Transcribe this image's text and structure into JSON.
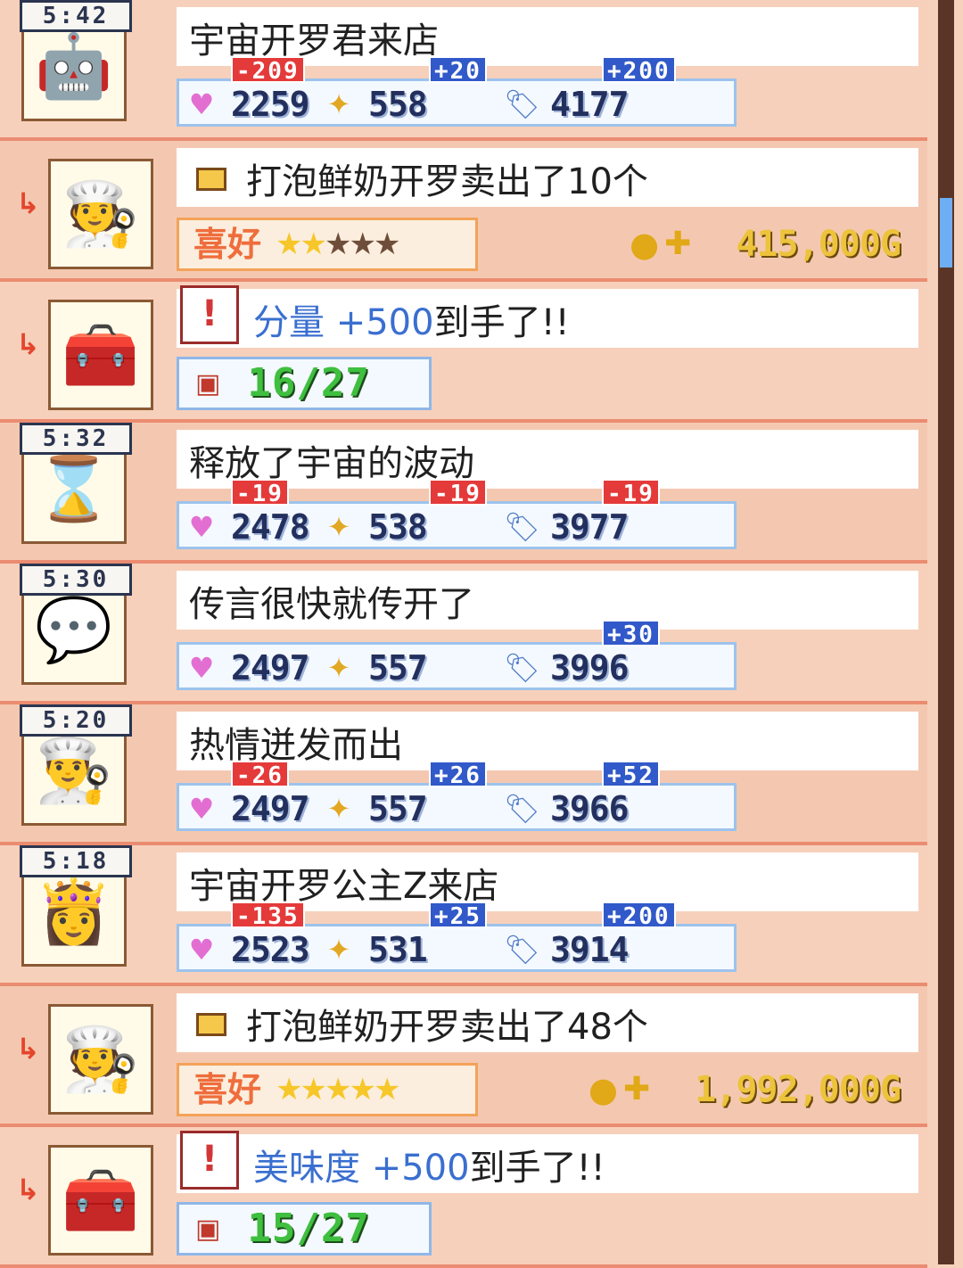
{
  "log": [
    {
      "type": "visit",
      "time": "5:42",
      "icon": "robot-customer-icon",
      "message": "宇宙开罗君来店",
      "stats": {
        "love": "2259",
        "spark": "558",
        "tag": "4177"
      },
      "deltas": {
        "love": "-209",
        "spark": "+20",
        "tag": "+200"
      }
    },
    {
      "type": "sale",
      "icon": "kitchen-counter-icon",
      "message": "打泡鲜奶开罗卖出了10个",
      "pref_label": "喜好",
      "stars_on": 2,
      "stars_total": 5,
      "gold": "415,000G"
    },
    {
      "type": "item",
      "icon": "treasure-chest-icon",
      "message_hl": "分量 +500",
      "message_tail": "到手了!!",
      "count": "16/27"
    },
    {
      "type": "event",
      "time": "5:32",
      "icon": "hourglass-icon",
      "message": "释放了宇宙的波动",
      "stats": {
        "love": "2478",
        "spark": "538",
        "tag": "3977"
      },
      "deltas": {
        "love": "-19",
        "spark": "-19",
        "tag": "-19"
      }
    },
    {
      "type": "event",
      "time": "5:30",
      "icon": "speech-bubble-icon",
      "message": "传言很快就传开了",
      "stats": {
        "love": "2497",
        "spark": "557",
        "tag": "3996"
      },
      "deltas": {
        "love": "",
        "spark": "",
        "tag": "+30"
      }
    },
    {
      "type": "event",
      "time": "5:20",
      "icon": "chef-icon",
      "message": "热情迸发而出",
      "stats": {
        "love": "2497",
        "spark": "557",
        "tag": "3966"
      },
      "deltas": {
        "love": "-26",
        "spark": "+26",
        "tag": "+52"
      }
    },
    {
      "type": "visit",
      "time": "5:18",
      "icon": "princess-customer-icon",
      "message": "宇宙开罗公主Z来店",
      "stats": {
        "love": "2523",
        "spark": "531",
        "tag": "3914"
      },
      "deltas": {
        "love": "-135",
        "spark": "+25",
        "tag": "+200"
      }
    },
    {
      "type": "sale",
      "icon": "kitchen-counter-icon",
      "message": "打泡鲜奶开罗卖出了48个",
      "pref_label": "喜好",
      "stars_on": 5,
      "stars_total": 5,
      "gold": "1,992,000G"
    },
    {
      "type": "item",
      "icon": "treasure-chest-icon",
      "message_hl": "美味度 +500",
      "message_tail": "到手了!!",
      "count": "15/27"
    }
  ],
  "glyphs": {
    "heart": "♥",
    "spark": "✦",
    "tag": "🏷",
    "coin": "●",
    "plus": "✚",
    "star": "★",
    "arrow": "↳",
    "item": "!",
    "chest": "▣"
  },
  "colors": {
    "highlight": "#3a6fd0",
    "negative": "#e43a3a",
    "positive": "#3159c9"
  }
}
